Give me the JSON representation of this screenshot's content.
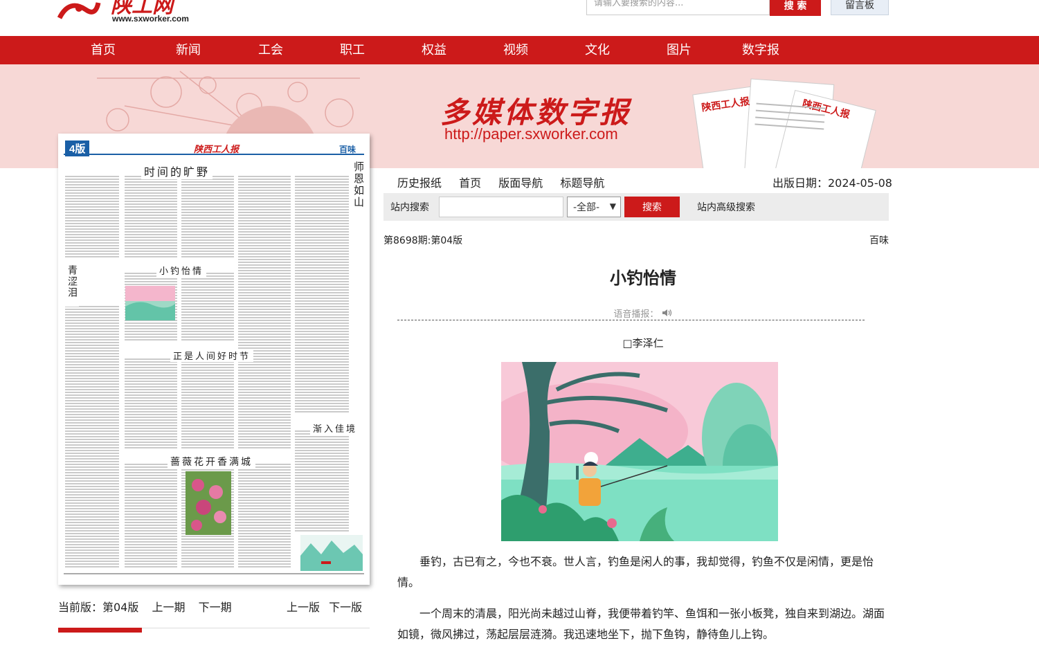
{
  "header": {
    "logo_url": "www.sxworker.com",
    "search_placeholder": "请输入要搜索的内容...",
    "search_button": "搜 索",
    "guestbook": "留言板"
  },
  "nav": [
    "首页",
    "新闻",
    "工会",
    "职工",
    "权益",
    "视频",
    "文化",
    "图片",
    "数字报"
  ],
  "banner": {
    "title": "多媒体数字报",
    "url": "http://paper.sxworker.com"
  },
  "paper_page": {
    "page_tag": "4版",
    "masthead": "陕西工人报",
    "section": "百味",
    "headlines": [
      "时间的旷野",
      "小钓怡情",
      "正是人间好时节",
      "渐入佳境",
      "蔷薇花开香满城"
    ],
    "vertical_headlines": [
      "师恩如山",
      "青涩泪"
    ]
  },
  "page_nav": {
    "current": "当前版：第04版",
    "prev_issue": "上一期",
    "next_issue": "下一期",
    "prev_page": "上一版",
    "next_page": "下一版"
  },
  "toolbar": {
    "links": [
      "历史报纸",
      "首页",
      "版面导航",
      "标题导航"
    ],
    "pub_date": "出版日期：2024-05-08"
  },
  "inner_search": {
    "label": "站内搜索",
    "select_value": "-全部-",
    "button": "搜索",
    "advanced": "站内高级搜索"
  },
  "article": {
    "issue": "第8698期:第04版",
    "section": "百味",
    "title": "小钓怡情",
    "voice_label": "语音播报：",
    "author": "□李泽仁",
    "paragraphs": [
      "垂钓，古已有之，今也不衰。世人言，钓鱼是闲人的事，我却觉得，钓鱼不仅是闲情，更是怡情。",
      "一个周末的清晨，阳光尚未越过山脊，我便带着钓竿、鱼饵和一张小板凳，独自来到湖边。湖面如镜，微风拂过，荡起层层涟漪。我迅速地坐下，抛下鱼钩，静待鱼儿上钩。"
    ]
  }
}
